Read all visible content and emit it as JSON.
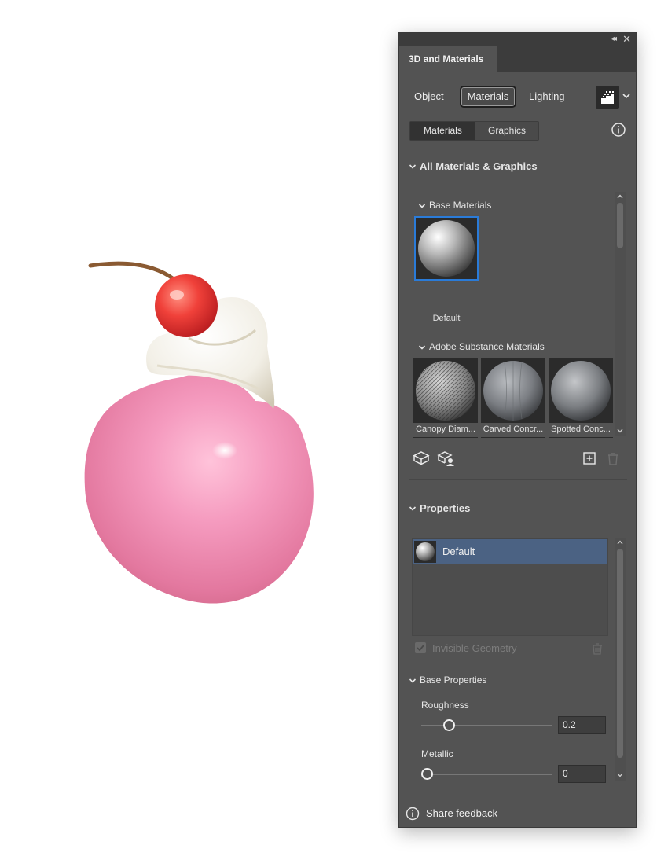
{
  "panel": {
    "title": "3D and Materials",
    "mode_tabs": [
      "Object",
      "Materials",
      "Lighting"
    ],
    "active_mode": "Materials",
    "sub_tabs": [
      "Materials",
      "Graphics"
    ],
    "active_sub_tab": "Materials"
  },
  "library": {
    "section_title": "All Materials & Graphics",
    "base_materials": {
      "title": "Base Materials",
      "items": [
        {
          "label": "Default",
          "selected": true
        }
      ]
    },
    "substance_materials": {
      "title": "Adobe Substance Materials",
      "items": [
        {
          "label": "Canopy Diam..."
        },
        {
          "label": "Carved Concr..."
        },
        {
          "label": "Spotted Conc..."
        }
      ]
    }
  },
  "properties": {
    "section_title": "Properties",
    "selected_material": "Default",
    "invisible_geometry_label": "Invisible Geometry",
    "base_properties_title": "Base Properties",
    "roughness": {
      "label": "Roughness",
      "value": "0.2",
      "fraction": 0.2
    },
    "metallic": {
      "label": "Metallic",
      "value": "0",
      "fraction": 0
    }
  },
  "footer": {
    "feedback_label": "Share feedback"
  },
  "colors": {
    "panel_bg": "#535353",
    "header_bg": "#3c3c3c",
    "selection_blue": "#2a7bd8",
    "selected_row": "#4b6283",
    "cake_pink": "#f08bb3",
    "cherry_red": "#e5302e"
  }
}
